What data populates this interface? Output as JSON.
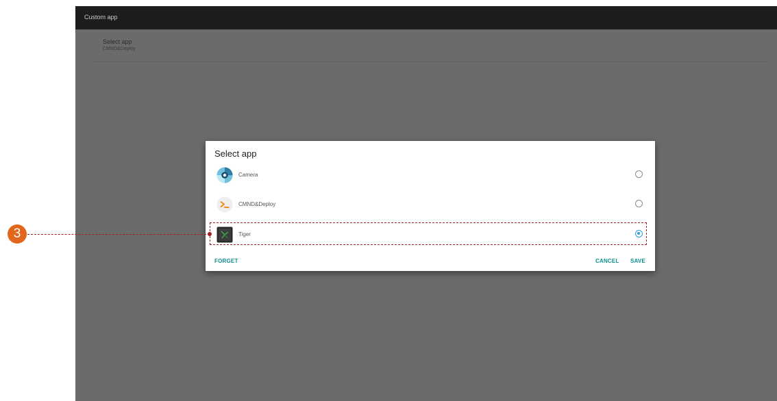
{
  "appbar": {
    "title": "Custom app"
  },
  "preference": {
    "title": "Select app",
    "summary": "CMND&Deploy"
  },
  "dialog": {
    "title": "Select app",
    "options": [
      {
        "label": "Camera",
        "icon": "camera-icon",
        "checked": false
      },
      {
        "label": "CMND&Deploy",
        "icon": "terminal-icon",
        "checked": false
      },
      {
        "label": "Tiger",
        "icon": "tiger-app-icon",
        "checked": true
      }
    ],
    "buttons": {
      "forget": "FORGET",
      "cancel": "CANCEL",
      "save": "SAVE"
    }
  },
  "annotation": {
    "number": "3"
  },
  "colors": {
    "accent": "#2f9fe0",
    "button_text": "#0f8f8f",
    "callout_badge": "#e2661b",
    "callout_line": "#a41e24"
  }
}
